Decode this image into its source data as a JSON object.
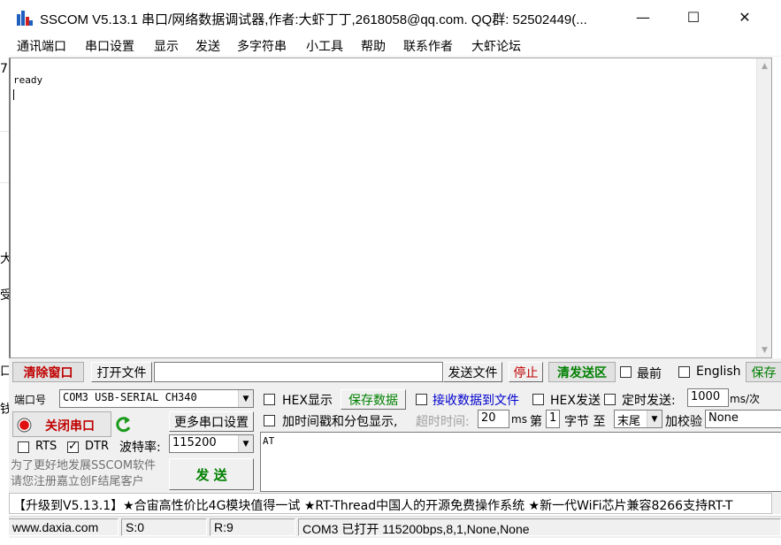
{
  "window": {
    "title": "SSCOM V5.13.1 串口/网络数据调试器,作者:大虾丁丁,2618058@qq.com. QQ群: 52502449(...",
    "minimize": "—",
    "maximize": "☐",
    "close": "✕"
  },
  "background_fragments": [
    "7",
    "大",
    "受",
    "口",
    "钱"
  ],
  "menu": [
    "通讯端口",
    "串口设置",
    "显示",
    "发送",
    "多字符串",
    "小工具",
    "帮助",
    "联系作者",
    "大虾论坛"
  ],
  "receive": {
    "text": "ready"
  },
  "toolbar": {
    "clear_window": "清除窗口",
    "open_file": "打开文件",
    "file_path": "",
    "send_file": "发送文件",
    "stop": "停止",
    "clear_send": "清发送区",
    "topmost": "最前",
    "topmost_checked": false,
    "english": "English",
    "english_checked": false,
    "save_config": "保存"
  },
  "port": {
    "label": "端口号",
    "value": "COM3 USB-SERIAL CH340",
    "close_port": "关闭串口",
    "more_settings": "更多串口设置",
    "rts": "RTS",
    "rts_checked": false,
    "dtr": "DTR",
    "dtr_checked": true,
    "baud_label": "波特率:",
    "baud": "115200",
    "promo": "为了更好地发展SSCOM软件\n请您注册嘉立创F结尾客户",
    "send": "发  送"
  },
  "options": {
    "hex_display": "HEX显示",
    "save_data": "保存数据",
    "recv_to_file": "接收数据到文件",
    "hex_send": "HEX发送",
    "timed_send": "定时发送:",
    "interval": "1000",
    "interval_unit": "ms/次",
    "add_timestamp": "加时间戳和分包显示,",
    "timeout_label": "超时时间:",
    "timeout": "20",
    "ms": "ms",
    "byte_label_1": "第",
    "byte_index": "1",
    "byte_label_2": "字节 至",
    "byte_end": "末尾",
    "checksum_label": "加校验",
    "checksum": "None"
  },
  "send_text": "AT",
  "ad": "【升级到V5.13.1】★合宙高性价比4G模块值得一试 ★RT-Thread中国人的开源免费操作系统 ★新一代WiFi芯片兼容8266支持RT-T",
  "status": {
    "url": "www.daxia.com",
    "sent": "S:0",
    "received": "R:9",
    "port_status": "COM3 已打开  115200bps,8,1,None,None"
  }
}
